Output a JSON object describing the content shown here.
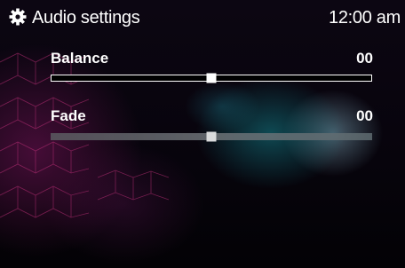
{
  "header": {
    "title": "Audio settings",
    "clock": "12:00 am",
    "icon": "gear-icon"
  },
  "settings": [
    {
      "label": "Balance",
      "value": "00",
      "position": 0.5,
      "selected": true
    },
    {
      "label": "Fade",
      "value": "00",
      "position": 0.5,
      "selected": false
    }
  ],
  "colors": {
    "text": "#ffffff",
    "track_active_bg": "#000000",
    "track_inactive": "#6e7378",
    "accent_pink": "#781a5a",
    "accent_teal": "#14828c"
  }
}
